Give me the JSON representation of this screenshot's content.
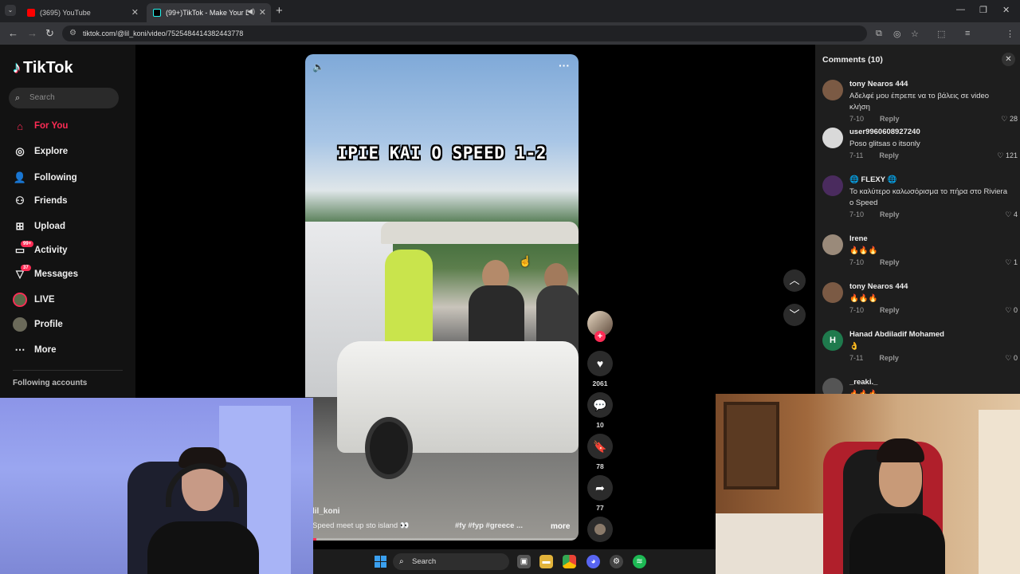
{
  "browser": {
    "tabs": [
      {
        "title": "(3695) YouTube"
      },
      {
        "title": "(99+)TikTok - Make Your Da"
      }
    ],
    "url": "tiktok.com/@lil_koni/video/7525484414382443778"
  },
  "sidebar": {
    "logo": "TikTok",
    "search_placeholder": "Search",
    "items": [
      {
        "label": "For You",
        "icon": "home-icon",
        "active": true
      },
      {
        "label": "Explore",
        "icon": "compass-icon"
      },
      {
        "label": "Following",
        "icon": "person-add-icon"
      },
      {
        "label": "Friends",
        "icon": "friends-icon"
      },
      {
        "label": "Upload",
        "icon": "upload-icon"
      },
      {
        "label": "Activity",
        "icon": "inbox-icon",
        "badge": "99+"
      },
      {
        "label": "Messages",
        "icon": "send-icon",
        "badge": "37"
      },
      {
        "label": "LIVE",
        "icon": "live-avatar-icon"
      },
      {
        "label": "Profile",
        "icon": "avatar-icon"
      },
      {
        "label": "More",
        "icon": "more-dots-icon"
      }
    ],
    "following_accounts_title": "Following accounts"
  },
  "video": {
    "overlay_title": "ΙΡΙΕ ΚΑΙ Ο SPEED 1-2",
    "username": "lil_koni",
    "description": "Speed meet up sto island 👀",
    "hashtags": "#fy  #fyp  #greece ...",
    "more_label": "more",
    "progress": 0.04
  },
  "actions": {
    "likes": "2061",
    "comments": "10",
    "saves": "78",
    "shares": "77"
  },
  "comments_panel": {
    "title": "Comments (10)",
    "items": [
      {
        "name": "tony Nearos 444",
        "text": "Αδελφέ μου έπρεπε να το βάλεις σε video κλήση",
        "date": "7-10",
        "reply": "Reply",
        "likes": "28",
        "avatar_color": "#7b5a44"
      },
      {
        "name": "user9960608927240",
        "text": "Poso glitsas o itsonly",
        "date": "7-11",
        "reply": "Reply",
        "likes": "121",
        "avatar_color": "#d9d9d9"
      },
      {
        "name": "🌐 FLEXY 🌐",
        "text": "Το καλύτερο καλωσόρισμα το πήρα στο Riviera ο Speed",
        "date": "7-10",
        "reply": "Reply",
        "likes": "4",
        "avatar_color": "#4a2b5e"
      },
      {
        "name": "Irene",
        "text": "🔥🔥🔥",
        "date": "7-10",
        "reply": "Reply",
        "likes": "1",
        "avatar_color": "#9a8a7a"
      },
      {
        "name": "tony Nearos 444",
        "text": "🔥🔥🔥",
        "date": "7-10",
        "reply": "Reply",
        "likes": "0",
        "avatar_color": "#7b5a44"
      },
      {
        "name": "Hanad Abdiladif Mohamed",
        "text": "👌",
        "date": "7-11",
        "reply": "Reply",
        "likes": "0",
        "avatar_color": "#1f7a4d",
        "initial": "H"
      },
      {
        "name": "_reaki._",
        "text": "🔥🔥🔥",
        "date": "",
        "reply": "",
        "likes": "",
        "avatar_color": "#555555"
      }
    ]
  },
  "taskbar": {
    "search_label": "Search"
  }
}
